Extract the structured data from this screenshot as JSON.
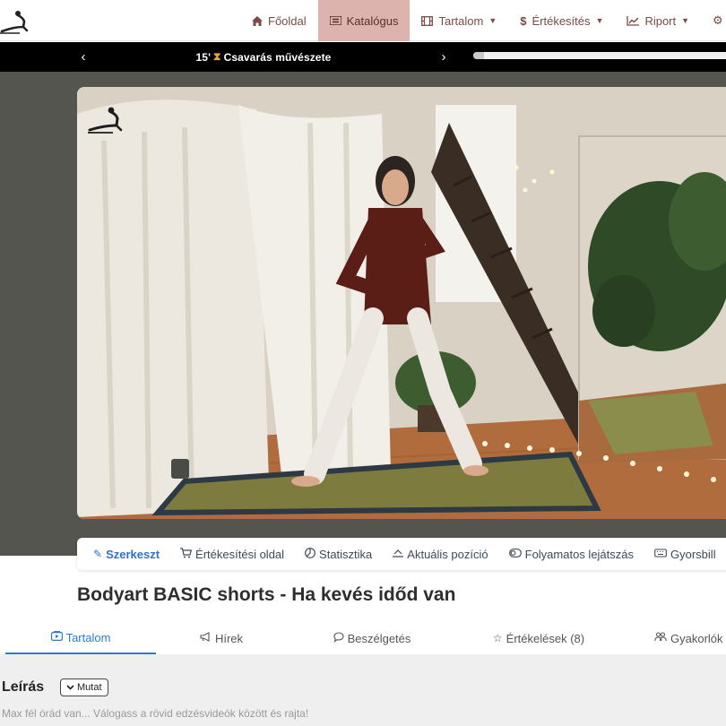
{
  "nav": {
    "items": [
      {
        "label": "Főoldal",
        "icon": "home-icon",
        "active": false,
        "dropdown": false
      },
      {
        "label": "Katalógus",
        "icon": "list-icon",
        "active": true,
        "dropdown": false
      },
      {
        "label": "Tartalom",
        "icon": "film-icon",
        "active": false,
        "dropdown": true
      },
      {
        "label": "Értékesítés",
        "icon": "dollar-icon",
        "active": false,
        "dropdown": true
      },
      {
        "label": "Riport",
        "icon": "chart-icon",
        "active": false,
        "dropdown": true
      }
    ],
    "settings_icon": "gear-icon"
  },
  "lesson_bar": {
    "prev": "‹",
    "next": "›",
    "duration": "15'",
    "title": "Csavarás művészete",
    "progress": 0.04
  },
  "actions": [
    {
      "label": "Szerkeszt",
      "icon": "edit-icon",
      "primary": true
    },
    {
      "label": "Értékesítési oldal",
      "icon": "cart-icon",
      "primary": false
    },
    {
      "label": "Statisztika",
      "icon": "stats-icon",
      "primary": false
    },
    {
      "label": "Aktuális pozíció",
      "icon": "position-icon",
      "primary": false
    },
    {
      "label": "Folyamatos lejátszás",
      "icon": "loop-icon",
      "primary": false
    },
    {
      "label": "Gyorsbill",
      "icon": "keyboard-icon",
      "primary": false
    }
  ],
  "lesson_title": "Bodyart BASIC shorts - Ha kevés időd van",
  "tabs": [
    {
      "label": "Tartalom",
      "icon": "video-icon",
      "active": true
    },
    {
      "label": "Hírek",
      "icon": "megaphone-icon",
      "active": false
    },
    {
      "label": "Beszélgetés",
      "icon": "chat-icon",
      "active": false
    },
    {
      "label": "Értékelések (8)",
      "icon": "star-icon",
      "active": false
    },
    {
      "label": "Gyakorlók",
      "icon": "people-icon",
      "active": false
    }
  ],
  "description": {
    "heading": "Leírás",
    "toggle": "Mutat",
    "text": "Max fél órád van... Válogass a rövid edzésvideók között és rajta!"
  },
  "colors": {
    "accent": "#2a7bd1",
    "nav_active_bg": "#dcb3ad",
    "nav_text": "#7a4a46"
  }
}
